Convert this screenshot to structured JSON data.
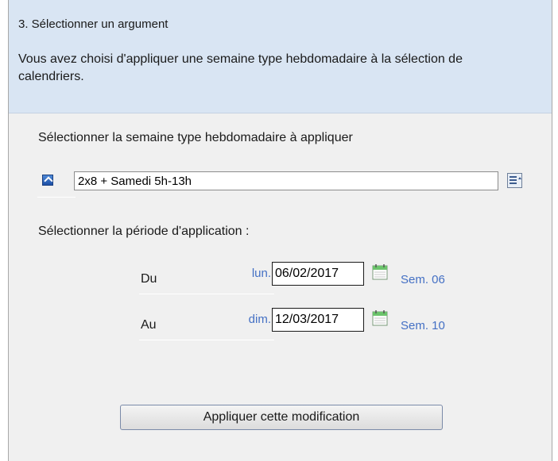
{
  "header": {
    "step_title": "3. Sélectionner un argument",
    "description": "Vous avez choisi d'appliquer une semaine type hebdomadaire à la sélection de calendriers."
  },
  "week_type": {
    "label": "Sélectionner la semaine type hebdomadaire à appliquer",
    "value": "2x8 + Samedi 5h-13h",
    "icon": "shortcut-arrow-icon",
    "picker_icon": "list-picker-icon"
  },
  "period": {
    "label": "Sélectionner la période d'application :",
    "from": {
      "label": "Du",
      "day_name": "lun.",
      "date": "06/02/2017",
      "week": "Sem. 06"
    },
    "to": {
      "label": "Au",
      "day_name": "dim.",
      "date": "12/03/2017",
      "week": "Sem. 10"
    }
  },
  "apply_button": {
    "label": "Appliquer cette modification"
  },
  "colors": {
    "header_bg": "#d9e5f3",
    "panel_bg": "#f0f0f0",
    "accent_text": "#4470c4"
  }
}
